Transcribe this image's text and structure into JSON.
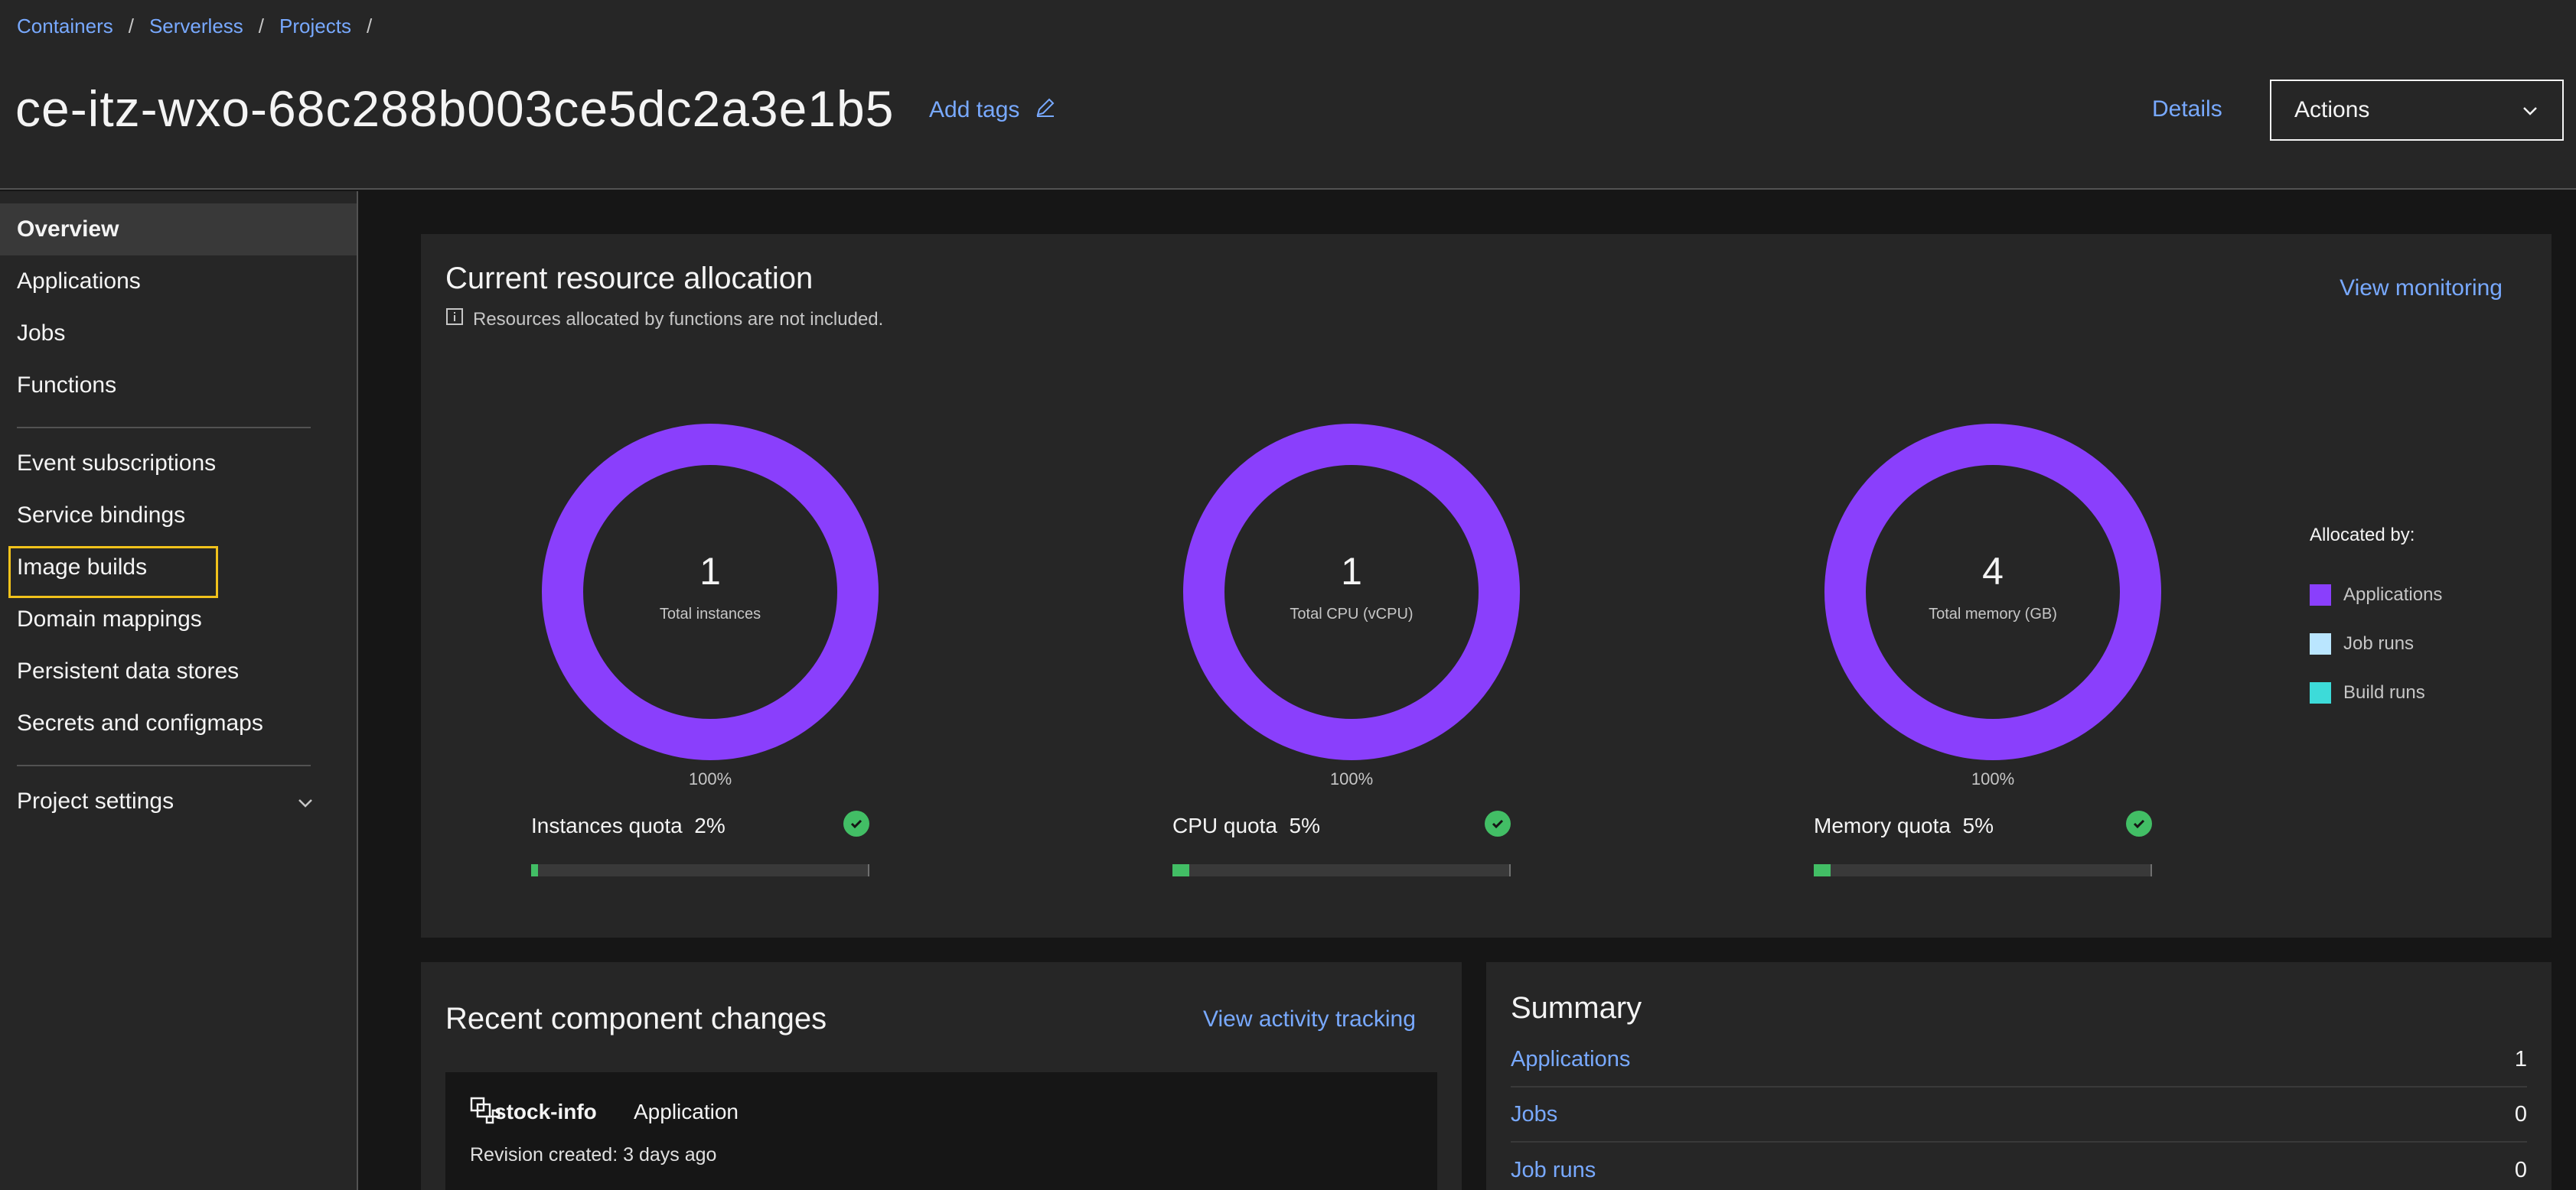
{
  "breadcrumb": [
    "Containers",
    "Serverless",
    "Projects"
  ],
  "header": {
    "title": "ce-itz-wxo-68c288b003ce5dc2a3e1b5",
    "add_tags": "Add tags",
    "details": "Details",
    "actions": "Actions"
  },
  "sidebar": {
    "items": [
      {
        "label": "Overview",
        "active": true
      },
      {
        "label": "Applications"
      },
      {
        "label": "Jobs"
      },
      {
        "label": "Functions"
      },
      {
        "label": "Event subscriptions"
      },
      {
        "label": "Service bindings"
      },
      {
        "label": "Image builds"
      },
      {
        "label": "Domain mappings"
      },
      {
        "label": "Persistent data stores"
      },
      {
        "label": "Secrets and configmaps"
      },
      {
        "label": "Project settings"
      }
    ]
  },
  "resource": {
    "title": "Current resource allocation",
    "note": "Resources allocated by functions are not included.",
    "view_monitoring": "View monitoring",
    "donuts": [
      {
        "value": "1",
        "label": "Total instances",
        "percent": "100%",
        "quota_label": "Instances quota",
        "quota_pct": "2%",
        "quota_fraction": 0.02
      },
      {
        "value": "1",
        "label": "Total CPU (vCPU)",
        "percent": "100%",
        "quota_label": "CPU quota",
        "quota_pct": "5%",
        "quota_fraction": 0.05
      },
      {
        "value": "4",
        "label": "Total memory (GB)",
        "percent": "100%",
        "quota_label": "Memory quota",
        "quota_pct": "5%",
        "quota_fraction": 0.05
      }
    ],
    "legend": {
      "title": "Allocated by:",
      "items": [
        {
          "label": "Applications",
          "color": "#8a3ffc"
        },
        {
          "label": "Job runs",
          "color": "#bae6ff"
        },
        {
          "label": "Build runs",
          "color": "#3ddbd9"
        }
      ]
    }
  },
  "recent": {
    "title": "Recent component changes",
    "view_activity": "View activity tracking",
    "items": [
      {
        "name": "stock-info",
        "type": "Application",
        "revision": "Revision created: 3 days ago"
      }
    ]
  },
  "summary": {
    "title": "Summary",
    "rows": [
      {
        "label": "Applications",
        "value": "1"
      },
      {
        "label": "Jobs",
        "value": "0"
      },
      {
        "label": "Job runs",
        "value": "0"
      }
    ]
  },
  "colors": {
    "accent_link": "#78a9ff",
    "donut": "#8a3ffc",
    "success": "#42be65",
    "focus": "#f1c21b"
  }
}
